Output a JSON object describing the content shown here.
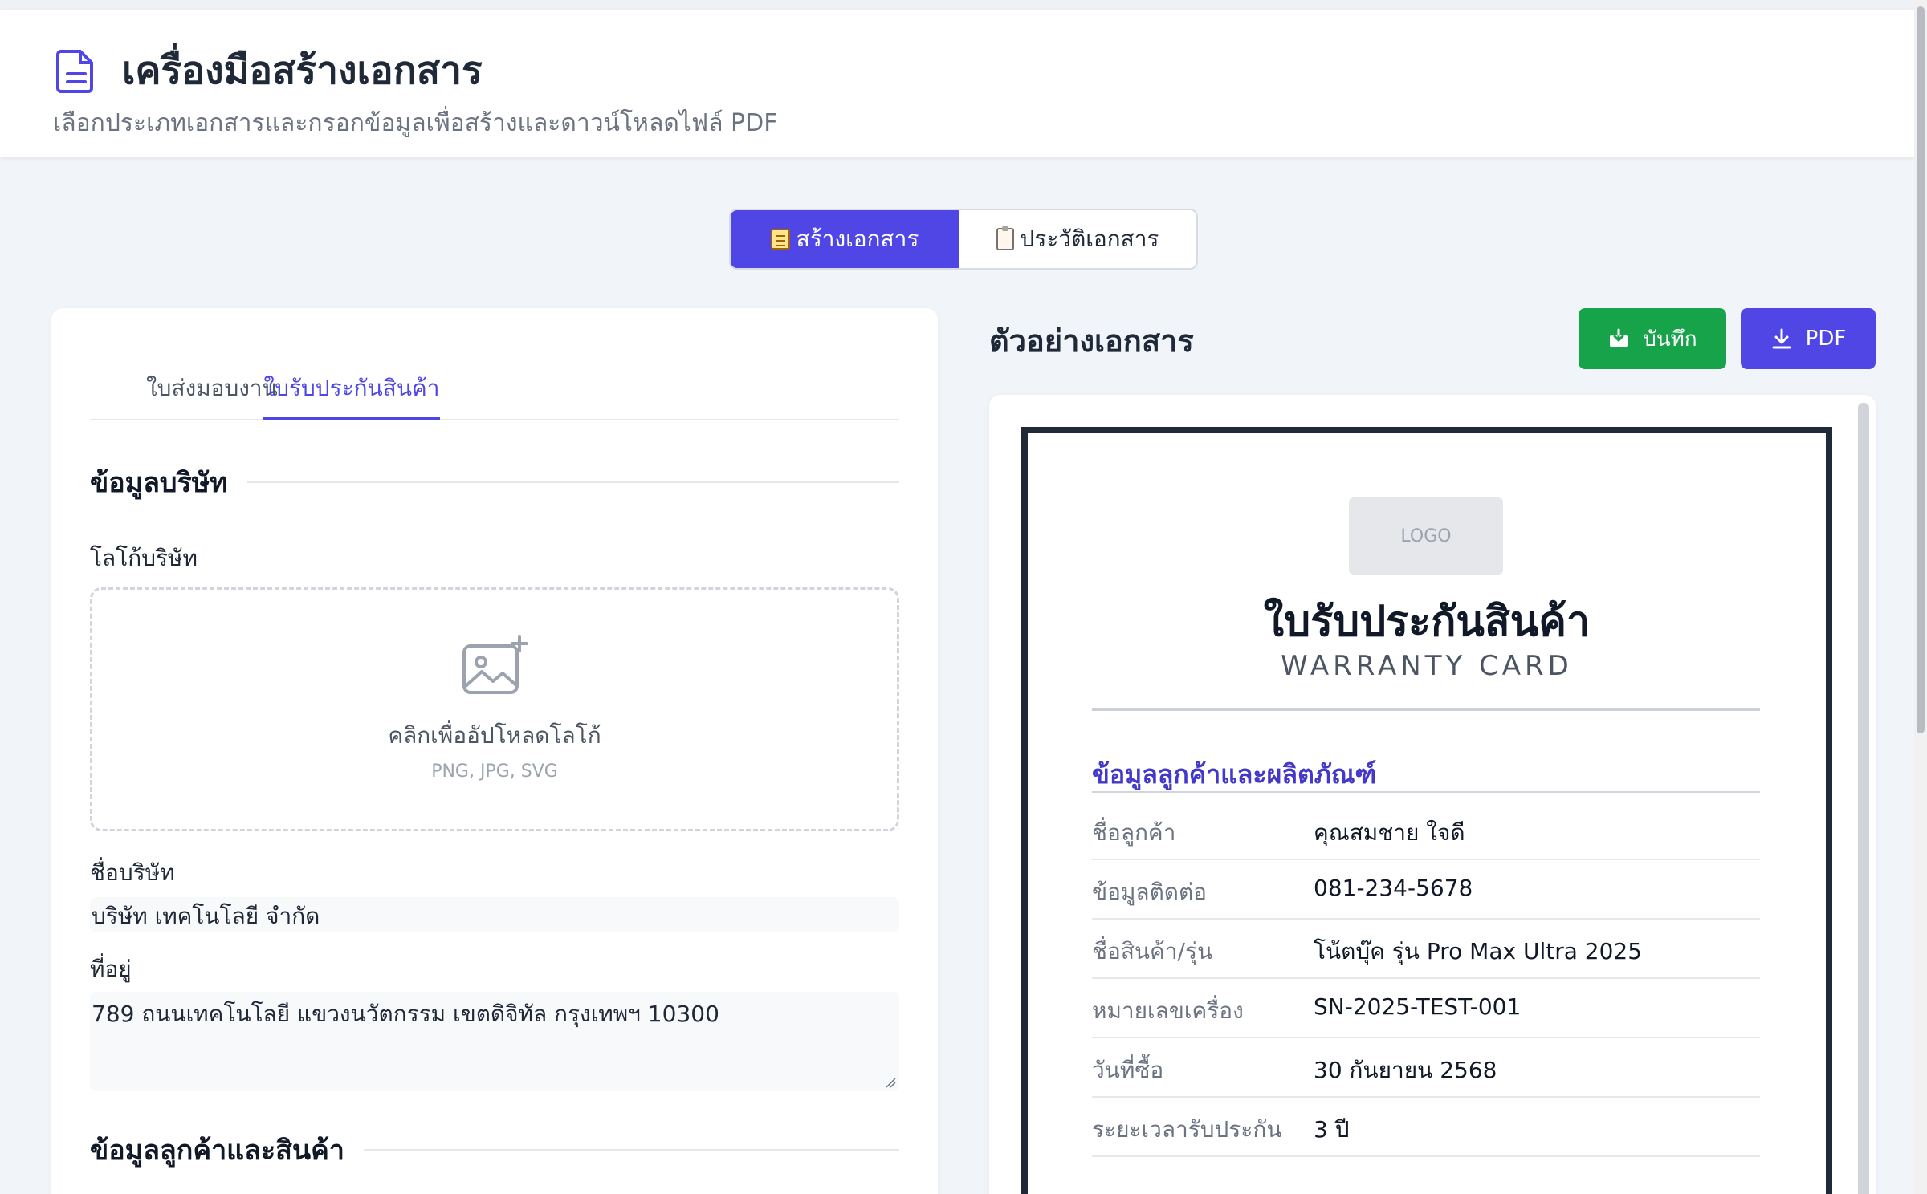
{
  "header": {
    "title": "เครื่องมือสร้างเอกสาร",
    "subtitle": "เลือกประเภทเอกสารและกรอกข้อมูลเพื่อสร้างและดาวน์โหลดไฟล์ PDF",
    "icon": "document-icon"
  },
  "view_toggle": {
    "create_label": "สร้างเอกสาร",
    "history_label": "ประวัติเอกสาร",
    "active": "create"
  },
  "form": {
    "doc_tabs": [
      {
        "label": "ใบส่งมอบงาน",
        "active": false
      },
      {
        "label": "ใบรับประกันสินค้า",
        "active": true
      }
    ],
    "company_section_title": "ข้อมูลบริษัท",
    "logo_label": "โลโก้บริษัท",
    "upload_text": "คลิกเพื่ออัปโหลดโลโก้",
    "upload_hint": "PNG, JPG, SVG",
    "company_name_label": "ชื่อบริษัท",
    "company_name_value": "บริษัท เทคโนโลยี จำกัด",
    "address_label": "ที่อยู่",
    "address_value": "789 ถนนเทคโนโลยี แขวงนวัตกรรม เขตดิจิทัล กรุงเทพฯ 10300",
    "customer_section_title": "ข้อมูลลูกค้าและสินค้า"
  },
  "preview": {
    "title": "ตัวอย่างเอกสาร",
    "save_label": "บันทึก",
    "pdf_label": "PDF",
    "logo_placeholder": "LOGO",
    "doc_title": "ใบรับประกันสินค้า",
    "doc_subtitle": "WARRANTY CARD",
    "section_title": "ข้อมูลลูกค้าและผลิตภัณฑ์",
    "rows": [
      {
        "label": "ชื่อลูกค้า",
        "value": "คุณสมชาย ใจดี"
      },
      {
        "label": "ข้อมูลติดต่อ",
        "value": "081-234-5678"
      },
      {
        "label": "ชื่อสินค้า/รุ่น",
        "value": "โน้ตบุ๊ค รุ่น Pro Max Ultra 2025"
      },
      {
        "label": "หมายเลขเครื่อง",
        "value": "SN-2025-TEST-001"
      },
      {
        "label": "วันที่ซื้อ",
        "value": "30 กันยายน 2568"
      },
      {
        "label": "ระยะเวลารับประกัน",
        "value": "3 ปี"
      }
    ]
  },
  "colors": {
    "accent": "#4f46e5",
    "save": "#16a34a",
    "background": "#f1f4f8"
  }
}
